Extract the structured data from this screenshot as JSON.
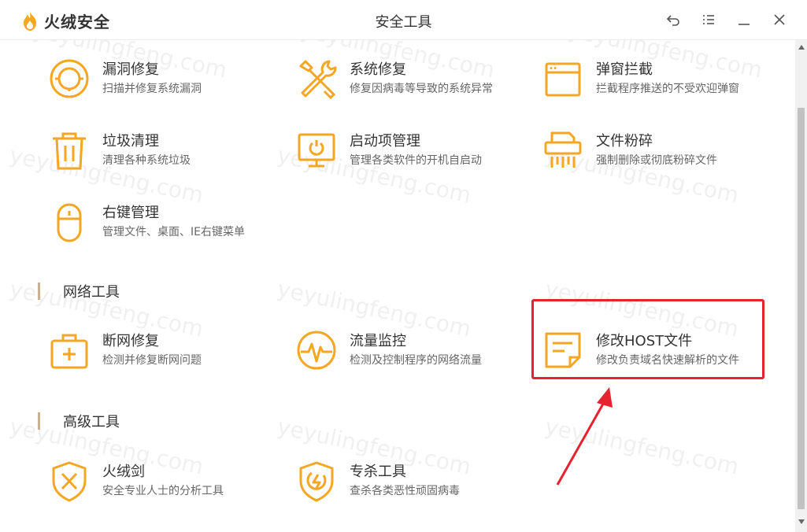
{
  "app": {
    "name": "火绒安全",
    "window_title": "安全工具"
  },
  "accent_color": "#f5a623",
  "highlight_color": "#e8212e",
  "watermark": "yeyulingfeng.com",
  "sections": {
    "network": "网络工具",
    "advanced": "高级工具"
  },
  "tools": {
    "vuln_fix": {
      "name": "漏洞修复",
      "desc": "扫描并修复系统漏洞",
      "icon": "vulnerability-icon"
    },
    "sys_repair": {
      "name": "系统修复",
      "desc": "修复因病毒等导致的系统异常",
      "icon": "tools-icon"
    },
    "popup_block": {
      "name": "弹窗拦截",
      "desc": "拦截程序推送的不受欢迎弹窗",
      "icon": "popup-window-icon"
    },
    "junk_clean": {
      "name": "垃圾清理",
      "desc": "清理各种系统垃圾",
      "icon": "trash-icon"
    },
    "startup_mgmt": {
      "name": "启动项管理",
      "desc": "管理各类软件的开机自启动",
      "icon": "monitor-power-icon"
    },
    "file_shred": {
      "name": "文件粉碎",
      "desc": "强制删除或彻底粉碎文件",
      "icon": "shredder-icon"
    },
    "context_menu": {
      "name": "右键管理",
      "desc": "管理文件、桌面、IE右键菜单",
      "icon": "mouse-icon"
    },
    "net_repair": {
      "name": "断网修复",
      "desc": "检测并修复断网问题",
      "icon": "first-aid-kit-icon"
    },
    "traffic_monitor": {
      "name": "流量监控",
      "desc": "检测及控制程序的网络流量",
      "icon": "pulse-gauge-icon"
    },
    "host_edit": {
      "name": "修改HOST文件",
      "desc": "修改负责域名快速解析的文件",
      "icon": "document-note-icon"
    },
    "sword": {
      "name": "火绒剑",
      "desc": "安全专业人士的分析工具",
      "icon": "crossed-swords-shield-icon"
    },
    "special_kill": {
      "name": "专杀工具",
      "desc": "查杀各类恶性顽固病毒",
      "icon": "shield-bolt-icon"
    }
  }
}
